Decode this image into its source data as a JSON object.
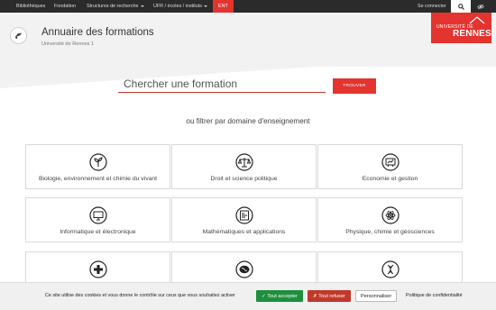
{
  "topnav": {
    "items": [
      {
        "label": "Bibliothèques"
      },
      {
        "label": "Fondation"
      },
      {
        "label": "Structures de recherche"
      },
      {
        "label": "UFR / écoles / instituts"
      },
      {
        "label": "ENT"
      }
    ],
    "login": "Se connecter",
    "icons": {
      "search": "search-icon",
      "accessibility": "eye-slash-icon"
    }
  },
  "header": {
    "title": "Annuaire des formations",
    "subtitle": "Université de Rennes 1",
    "logo_line1": "UNIVERSITÉ DE",
    "logo_line2": "RENNES",
    "brand_color": "#e3342f"
  },
  "search": {
    "placeholder": "Chercher une formation",
    "button": "TROUVER"
  },
  "filter_label": "ou filtrer par domaine d'enseignement",
  "domains": [
    {
      "label": "Biologie, environnement et chimie du vivant",
      "icon": "plant-icon"
    },
    {
      "label": "Droit et science politique",
      "icon": "scales-icon"
    },
    {
      "label": "Economie et gestion",
      "icon": "chart-board-icon"
    },
    {
      "label": "Informatique et électronique",
      "icon": "monitor-icon"
    },
    {
      "label": "Mathématiques et applications",
      "icon": "formula-board-icon"
    },
    {
      "label": "Physique, chimie et géosciences",
      "icon": "atom-icon"
    },
    {
      "label": "",
      "icon": "medical-cross-icon"
    },
    {
      "label": "",
      "icon": "brain-icon"
    },
    {
      "label": "",
      "icon": "dna-icon"
    }
  ],
  "cookies": {
    "text": "Ce site utilise des cookies et vous donne le contrôle sur ceux que vous souhaitez activer",
    "accept": "✓ Tout accepter",
    "refuse": "✗ Tout refuser",
    "customize": "Personnaliser",
    "policy": "Politique de confidentialité"
  }
}
